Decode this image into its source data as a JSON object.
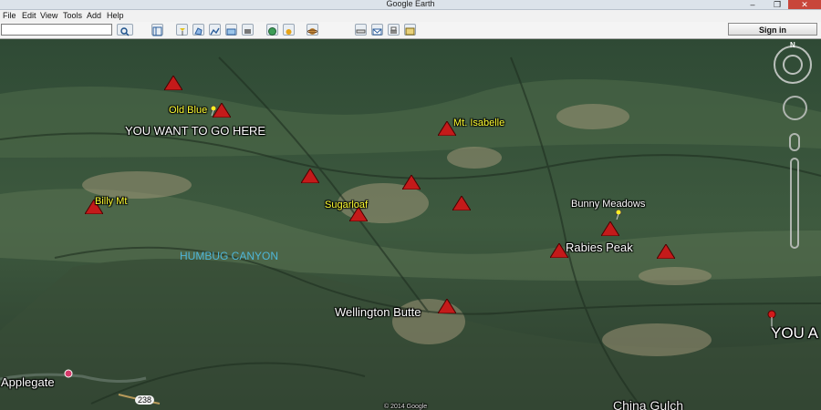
{
  "app": {
    "title": "Google Earth"
  },
  "window": {
    "minimize": "–",
    "maximize": "❐",
    "close": "✕"
  },
  "menu": [
    "File",
    "Edit",
    "View",
    "Tools",
    "Add",
    "Help"
  ],
  "toolbar": {
    "search_placeholder": "",
    "search_icon": "search-icon",
    "sign_in": "Sign in"
  },
  "map": {
    "labels": {
      "old_blue": "Old Blue",
      "you_want": "YOU WANT TO GO HERE",
      "mt_isabelle": "Mt. Isabelle",
      "billy_mt": "Billy Mt",
      "sugarloaf": "Sugarloaf",
      "bunny_meadows": "Bunny Meadows",
      "rabies_peak": "Rabies Peak",
      "humbug": "HUMBUG CANYON",
      "wellington": "Wellington Butte",
      "you_a": "YOU A",
      "applegate": "Applegate",
      "hwy": "238",
      "china_gulch": "China Gulch",
      "copyright": "© 2014 Google"
    },
    "nav": {
      "north": "N"
    },
    "colors": {
      "marker": "#c41a1a",
      "label_yellow": "#ffff33",
      "label_teal": "#4fb6d8"
    }
  }
}
